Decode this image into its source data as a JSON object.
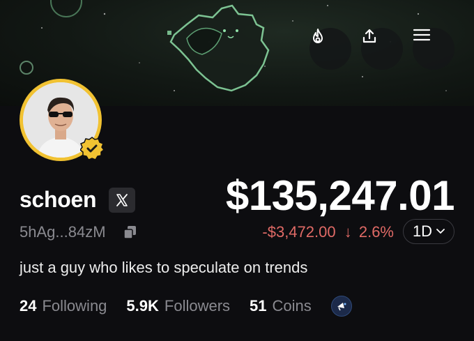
{
  "banner": {
    "actions": [
      {
        "name": "flame-icon"
      },
      {
        "name": "share-icon"
      },
      {
        "name": "menu-icon"
      }
    ]
  },
  "profile": {
    "username": "schoen",
    "address": "5hAg...84zM",
    "verified": true,
    "bio": "just a guy who likes to speculate on trends"
  },
  "portfolio": {
    "balance": "$135,247.01",
    "change_amount": "-$3,472.00",
    "change_arrow": "↓",
    "change_percent": "2.6%",
    "period": "1D"
  },
  "stats": {
    "following_count": "24",
    "following_label": "Following",
    "followers_count": "5.9K",
    "followers_label": "Followers",
    "coins_count": "51",
    "coins_label": "Coins"
  },
  "colors": {
    "background": "#0d0d10",
    "negative": "#e06a66",
    "avatar_ring": "#f1c232",
    "muted_text": "#8a8a90"
  }
}
